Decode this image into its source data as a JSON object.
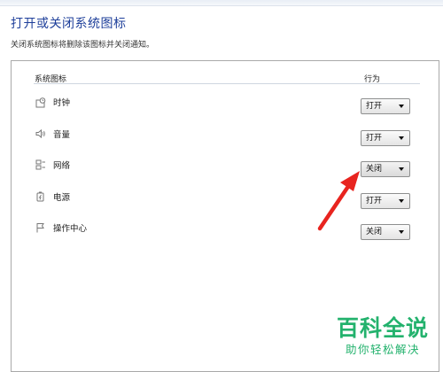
{
  "header": {
    "title": "打开或关闭系统图标",
    "subtitle": "关闭系统图标将删除该图标并关闭通知。"
  },
  "columns": {
    "system_icon": "系统图标",
    "behavior": "行为"
  },
  "rows": [
    {
      "label": "时钟",
      "icon": "clock-icon",
      "value": "打开"
    },
    {
      "label": "音量",
      "icon": "volume-icon",
      "value": "打开"
    },
    {
      "label": "网络",
      "icon": "network-icon",
      "value": "关闭"
    },
    {
      "label": "电源",
      "icon": "power-icon",
      "value": "打开"
    },
    {
      "label": "操作中心",
      "icon": "action-center-flag-icon",
      "value": "关闭"
    }
  ],
  "annotation": {
    "arrow_color": "#e8241f"
  },
  "watermark": {
    "main": "百科全说",
    "sub": "助你轻松解决",
    "color": "#23b26d"
  }
}
